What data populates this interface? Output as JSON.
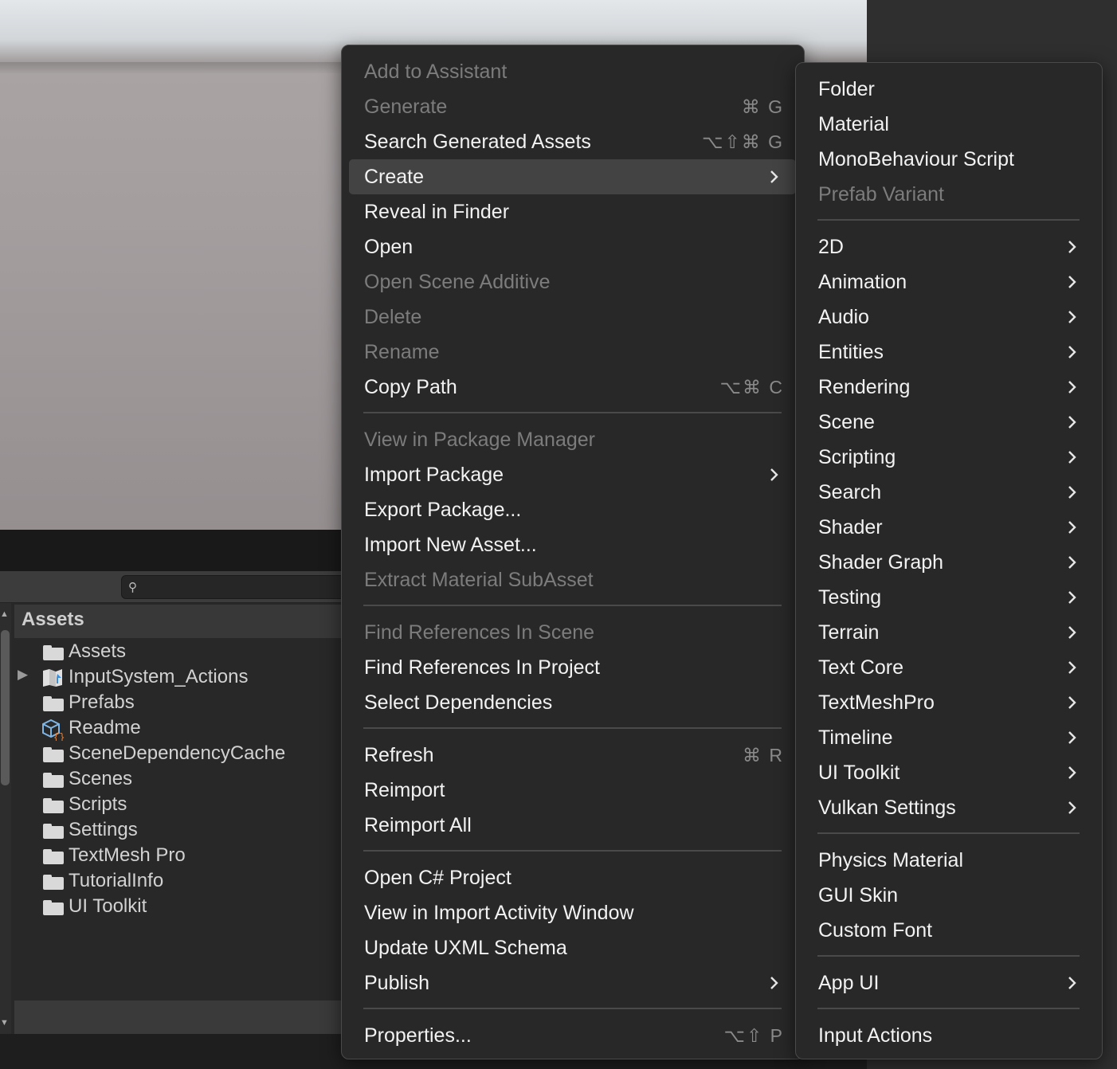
{
  "project": {
    "search_placeholder": "",
    "search_value": "",
    "breadcrumb": "Assets",
    "items": [
      {
        "label": "Assets",
        "icon": "folder-icon",
        "expandable": false
      },
      {
        "label": "InputSystem_Actions",
        "icon": "input-actions-icon",
        "expandable": true
      },
      {
        "label": "Prefabs",
        "icon": "folder-icon",
        "expandable": false
      },
      {
        "label": "Readme",
        "icon": "readme-icon",
        "expandable": false
      },
      {
        "label": "SceneDependencyCache",
        "icon": "folder-icon",
        "expandable": false
      },
      {
        "label": "Scenes",
        "icon": "folder-icon",
        "expandable": false
      },
      {
        "label": "Scripts",
        "icon": "folder-icon",
        "expandable": false
      },
      {
        "label": "Settings",
        "icon": "folder-icon",
        "expandable": false
      },
      {
        "label": "TextMesh Pro",
        "icon": "folder-icon",
        "expandable": false
      },
      {
        "label": "TutorialInfo",
        "icon": "folder-icon",
        "expandable": false
      },
      {
        "label": "UI Toolkit",
        "icon": "folder-icon",
        "expandable": false
      }
    ]
  },
  "context_menu": {
    "add_to_assistant": "Add to Assistant",
    "generate": "Generate",
    "generate_shortcut": "⌘ G",
    "search_generated": "Search Generated Assets",
    "search_generated_shortcut": "⌥⇧⌘ G",
    "create": "Create",
    "reveal_in_finder": "Reveal in Finder",
    "open": "Open",
    "open_scene_additive": "Open Scene Additive",
    "delete": "Delete",
    "rename": "Rename",
    "copy_path": "Copy Path",
    "copy_path_shortcut": "⌥⌘ C",
    "view_in_package_manager": "View in Package Manager",
    "import_package": "Import Package",
    "export_package": "Export Package...",
    "import_new_asset": "Import New Asset...",
    "extract_material": "Extract Material SubAsset",
    "find_refs_scene": "Find References In Scene",
    "find_refs_project": "Find References In Project",
    "select_dependencies": "Select Dependencies",
    "refresh": "Refresh",
    "refresh_shortcut": "⌘ R",
    "reimport": "Reimport",
    "reimport_all": "Reimport All",
    "open_csharp": "Open C# Project",
    "view_import_activity": "View in Import Activity Window",
    "update_uxml": "Update UXML Schema",
    "publish": "Publish",
    "properties": "Properties...",
    "properties_shortcut": "⌥⇧ P"
  },
  "create_submenu": {
    "folder": "Folder",
    "material": "Material",
    "mono_script": "MonoBehaviour Script",
    "prefab_variant": "Prefab Variant",
    "two_d": "2D",
    "animation": "Animation",
    "audio": "Audio",
    "entities": "Entities",
    "rendering": "Rendering",
    "scene": "Scene",
    "scripting": "Scripting",
    "search": "Search",
    "shader": "Shader",
    "shader_graph": "Shader Graph",
    "testing": "Testing",
    "terrain": "Terrain",
    "text_core": "Text Core",
    "textmeshpro": "TextMeshPro",
    "timeline": "Timeline",
    "ui_toolkit": "UI Toolkit",
    "vulkan_settings": "Vulkan Settings",
    "physics_material": "Physics Material",
    "gui_skin": "GUI Skin",
    "custom_font": "Custom Font",
    "app_ui": "App UI",
    "input_actions": "Input Actions"
  },
  "colors": {
    "menu_bg": "#282828",
    "highlight": "#434343",
    "text": "#f2f2f2",
    "disabled_text": "#7c7c7c"
  }
}
